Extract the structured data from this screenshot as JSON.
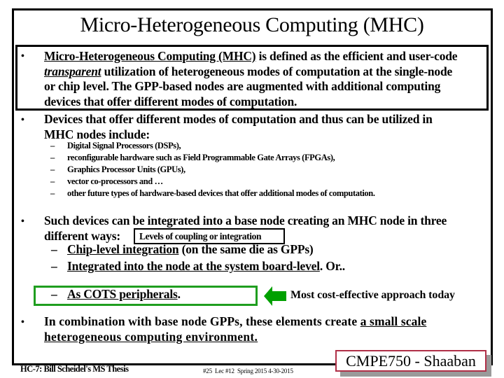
{
  "slide": {
    "title": "Micro-Heterogeneous Computing (MHC)",
    "bullet_glyph": "•",
    "dash_glyph": "–",
    "definition": {
      "term": "Micro-Heterogeneous Computing (MHC)",
      "text1": " is defined as the efficient and user-code",
      "emphasis": "transparent",
      "text2": " utilization of  heterogeneous modes of computation at the single-node",
      "text3": "or chip level.   The GPP-based nodes are augmented with additional computing",
      "text4": "devices that offer different modes of computation."
    },
    "devices": {
      "line1": "Devices that offer different modes of computation  and thus can be utilized in",
      "line2": "MHC nodes include:",
      "items": [
        "Digital Signal Processors  (DSPs),",
        "reconfigurable hardware such as Field Programmable Gate Arrays (FPGAs),",
        "Graphics Processor Units (GPUs),",
        "vector co-processors and …",
        "other future types of hardware-based devices  that offer additional modes of computation."
      ]
    },
    "integration": {
      "line1": "Such devices can be integrated into a base node creating an MHC node in three",
      "line2": "different ways:",
      "callout": "Levels of coupling or integration",
      "ways": [
        {
          "underlined": "Chip-level integration",
          "rest": " (on the same die as GPPs)"
        },
        {
          "underlined": "Integrated into the node at the system board-level",
          "rest": ".    Or.."
        },
        {
          "underlined": "As COTS peripherals",
          "rest": "."
        }
      ],
      "annotation": "Most cost-effective approach today",
      "annotation_color": "#00a000"
    },
    "combination": {
      "line1_plain": "In combination with base node GPPs, these elements create ",
      "line1_underlined": "a small scale",
      "line2_underlined": "heterogeneous computing environment."
    }
  },
  "footer": {
    "left": "HC-7: Bill Scheidel's MS Thesis",
    "slide_number": "#25",
    "lecture": "Lec #12",
    "term": "Spring 2015",
    "date": "4-30-2015",
    "brand": "CMPE750 - Shaaban",
    "brand_border_color": "#b03048"
  }
}
